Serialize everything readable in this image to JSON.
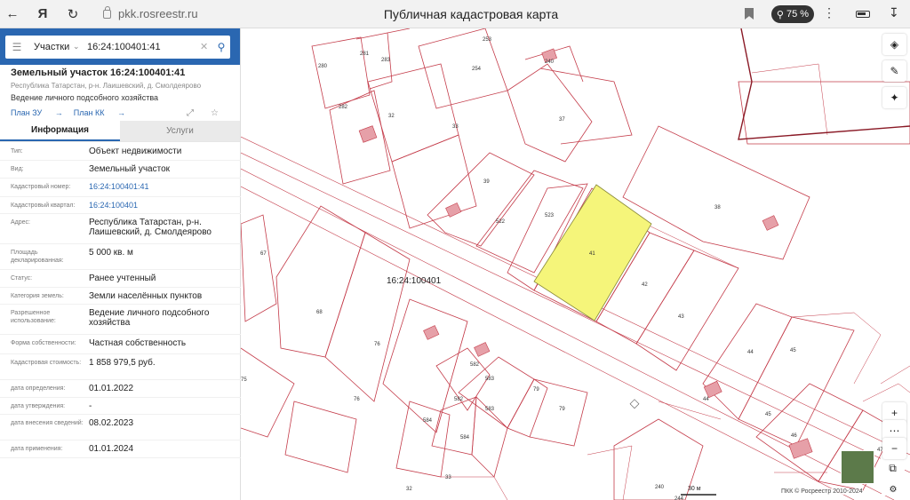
{
  "browser": {
    "url": "pkk.rosreestr.ru",
    "page_title": "Публичная кадастровая карта",
    "zoom": "75 %",
    "back_icon": "arrow-left-icon",
    "yandex_icon": "yandex-logo-icon",
    "reload_icon": "reload-icon",
    "lock_icon": "lock-icon",
    "bookmark_icon": "bookmark-icon",
    "zoom_icon": "magnifier-icon",
    "menu_icon": "dots-menu-icon",
    "battery_icon": "battery-icon",
    "download_icon": "download-icon"
  },
  "search": {
    "category": "Участки",
    "query": "16:24:100401:41"
  },
  "object": {
    "title": "Земельный участок 16:24:100401:41",
    "address": "Республика Татарстан, р-н. Лаишевский, д. Смолдеярово",
    "usage": "Ведение личного подсобного хозяйства",
    "plan_zu": "План ЗУ",
    "plan_kk": "План КК"
  },
  "tabs": [
    "Информация",
    "Услуги"
  ],
  "properties": [
    {
      "label": "Тип:",
      "value": "Объект недвижимости"
    },
    {
      "label": "Вид:",
      "value": "Земельный участок"
    },
    {
      "label": "Кадастровый номер:",
      "value": "16:24:100401:41",
      "link": true
    },
    {
      "label": "Кадастровый квартал:",
      "value": "16:24:100401",
      "link": true
    },
    {
      "label": "Адрес:",
      "value": "Республика Татарстан, р-н. Лаишевский, д. Смолдеярово"
    },
    {
      "label": "Площадь декларированная:",
      "value": "5 000 кв. м"
    },
    {
      "label": "Статус:",
      "value": "Ранее учтенный"
    },
    {
      "label": "Категория земель:",
      "value": "Земли населённых пунктов"
    },
    {
      "label": "Разрешенное использование:",
      "value": "Ведение личного подсобного хозяйства"
    },
    {
      "label": "Форма собственности:",
      "value": "Частная собственность"
    },
    {
      "label": "Кадастровая стоимость:",
      "value": "1 858 979,5 руб."
    },
    {
      "label": "дата определения:",
      "value": "01.01.2022"
    },
    {
      "label": "дата утверждения:",
      "value": "-"
    },
    {
      "label": "дата внесения сведений:",
      "value": "08.02.2023"
    },
    {
      "label": "дата применения:",
      "value": "01.01.2024"
    }
  ],
  "map": {
    "quarter_label": "16:24:100401",
    "scale": "30 м",
    "copyright": "ПКК © Росреестр 2010-2024",
    "parcel_labels": [
      "280",
      "281",
      "283",
      "253",
      "254",
      "282",
      "240",
      "32",
      "33",
      "37",
      "39",
      "522",
      "523",
      "41",
      "42",
      "43",
      "38",
      "67",
      "68",
      "76",
      "75",
      "76",
      "582",
      "583",
      "79",
      "79",
      "582",
      "583",
      "584",
      "584",
      "44",
      "45",
      "45",
      "44",
      "46",
      "47",
      "240",
      "244",
      "32",
      "33"
    ],
    "selected_fill": "#f5f57a",
    "boundary_color": "#c43c4a",
    "controls": [
      "layers-icon",
      "ruler-icon",
      "locate-icon",
      "zoom-in-icon",
      "more-icon",
      "zoom-out-icon"
    ]
  }
}
